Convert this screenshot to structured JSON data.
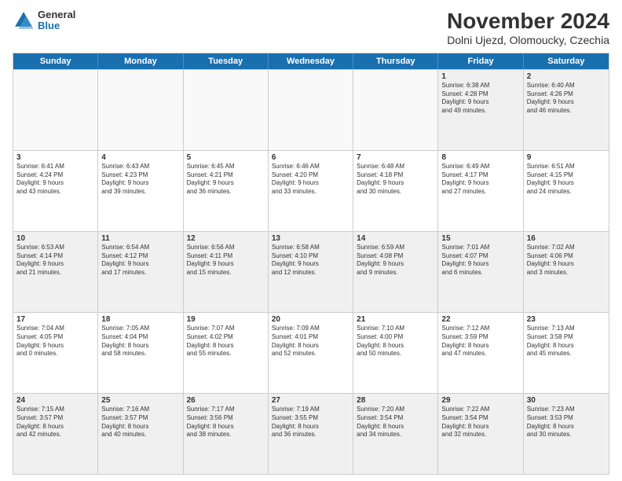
{
  "header": {
    "logo": {
      "general": "General",
      "blue": "Blue"
    },
    "title": "November 2024",
    "subtitle": "Dolni Ujezd, Olomoucky, Czechia"
  },
  "weekdays": [
    "Sunday",
    "Monday",
    "Tuesday",
    "Wednesday",
    "Thursday",
    "Friday",
    "Saturday"
  ],
  "rows": [
    [
      {
        "day": "",
        "info": "",
        "empty": true
      },
      {
        "day": "",
        "info": "",
        "empty": true
      },
      {
        "day": "",
        "info": "",
        "empty": true
      },
      {
        "day": "",
        "info": "",
        "empty": true
      },
      {
        "day": "",
        "info": "",
        "empty": true
      },
      {
        "day": "1",
        "info": "Sunrise: 6:38 AM\nSunset: 4:28 PM\nDaylight: 9 hours\nand 49 minutes.",
        "empty": false
      },
      {
        "day": "2",
        "info": "Sunrise: 6:40 AM\nSunset: 4:26 PM\nDaylight: 9 hours\nand 46 minutes.",
        "empty": false
      }
    ],
    [
      {
        "day": "3",
        "info": "Sunrise: 6:41 AM\nSunset: 4:24 PM\nDaylight: 9 hours\nand 43 minutes.",
        "empty": false
      },
      {
        "day": "4",
        "info": "Sunrise: 6:43 AM\nSunset: 4:23 PM\nDaylight: 9 hours\nand 39 minutes.",
        "empty": false
      },
      {
        "day": "5",
        "info": "Sunrise: 6:45 AM\nSunset: 4:21 PM\nDaylight: 9 hours\nand 36 minutes.",
        "empty": false
      },
      {
        "day": "6",
        "info": "Sunrise: 6:46 AM\nSunset: 4:20 PM\nDaylight: 9 hours\nand 33 minutes.",
        "empty": false
      },
      {
        "day": "7",
        "info": "Sunrise: 6:48 AM\nSunset: 4:18 PM\nDaylight: 9 hours\nand 30 minutes.",
        "empty": false
      },
      {
        "day": "8",
        "info": "Sunrise: 6:49 AM\nSunset: 4:17 PM\nDaylight: 9 hours\nand 27 minutes.",
        "empty": false
      },
      {
        "day": "9",
        "info": "Sunrise: 6:51 AM\nSunset: 4:15 PM\nDaylight: 9 hours\nand 24 minutes.",
        "empty": false
      }
    ],
    [
      {
        "day": "10",
        "info": "Sunrise: 6:53 AM\nSunset: 4:14 PM\nDaylight: 9 hours\nand 21 minutes.",
        "empty": false
      },
      {
        "day": "11",
        "info": "Sunrise: 6:54 AM\nSunset: 4:12 PM\nDaylight: 9 hours\nand 17 minutes.",
        "empty": false
      },
      {
        "day": "12",
        "info": "Sunrise: 6:56 AM\nSunset: 4:11 PM\nDaylight: 9 hours\nand 15 minutes.",
        "empty": false
      },
      {
        "day": "13",
        "info": "Sunrise: 6:58 AM\nSunset: 4:10 PM\nDaylight: 9 hours\nand 12 minutes.",
        "empty": false
      },
      {
        "day": "14",
        "info": "Sunrise: 6:59 AM\nSunset: 4:08 PM\nDaylight: 9 hours\nand 9 minutes.",
        "empty": false
      },
      {
        "day": "15",
        "info": "Sunrise: 7:01 AM\nSunset: 4:07 PM\nDaylight: 9 hours\nand 6 minutes.",
        "empty": false
      },
      {
        "day": "16",
        "info": "Sunrise: 7:02 AM\nSunset: 4:06 PM\nDaylight: 9 hours\nand 3 minutes.",
        "empty": false
      }
    ],
    [
      {
        "day": "17",
        "info": "Sunrise: 7:04 AM\nSunset: 4:05 PM\nDaylight: 9 hours\nand 0 minutes.",
        "empty": false
      },
      {
        "day": "18",
        "info": "Sunrise: 7:05 AM\nSunset: 4:04 PM\nDaylight: 8 hours\nand 58 minutes.",
        "empty": false
      },
      {
        "day": "19",
        "info": "Sunrise: 7:07 AM\nSunset: 4:02 PM\nDaylight: 8 hours\nand 55 minutes.",
        "empty": false
      },
      {
        "day": "20",
        "info": "Sunrise: 7:09 AM\nSunset: 4:01 PM\nDaylight: 8 hours\nand 52 minutes.",
        "empty": false
      },
      {
        "day": "21",
        "info": "Sunrise: 7:10 AM\nSunset: 4:00 PM\nDaylight: 8 hours\nand 50 minutes.",
        "empty": false
      },
      {
        "day": "22",
        "info": "Sunrise: 7:12 AM\nSunset: 3:59 PM\nDaylight: 8 hours\nand 47 minutes.",
        "empty": false
      },
      {
        "day": "23",
        "info": "Sunrise: 7:13 AM\nSunset: 3:58 PM\nDaylight: 8 hours\nand 45 minutes.",
        "empty": false
      }
    ],
    [
      {
        "day": "24",
        "info": "Sunrise: 7:15 AM\nSunset: 3:57 PM\nDaylight: 8 hours\nand 42 minutes.",
        "empty": false
      },
      {
        "day": "25",
        "info": "Sunrise: 7:16 AM\nSunset: 3:57 PM\nDaylight: 8 hours\nand 40 minutes.",
        "empty": false
      },
      {
        "day": "26",
        "info": "Sunrise: 7:17 AM\nSunset: 3:56 PM\nDaylight: 8 hours\nand 38 minutes.",
        "empty": false
      },
      {
        "day": "27",
        "info": "Sunrise: 7:19 AM\nSunset: 3:55 PM\nDaylight: 8 hours\nand 36 minutes.",
        "empty": false
      },
      {
        "day": "28",
        "info": "Sunrise: 7:20 AM\nSunset: 3:54 PM\nDaylight: 8 hours\nand 34 minutes.",
        "empty": false
      },
      {
        "day": "29",
        "info": "Sunrise: 7:22 AM\nSunset: 3:54 PM\nDaylight: 8 hours\nand 32 minutes.",
        "empty": false
      },
      {
        "day": "30",
        "info": "Sunrise: 7:23 AM\nSunset: 3:53 PM\nDaylight: 8 hours\nand 30 minutes.",
        "empty": false
      }
    ]
  ]
}
